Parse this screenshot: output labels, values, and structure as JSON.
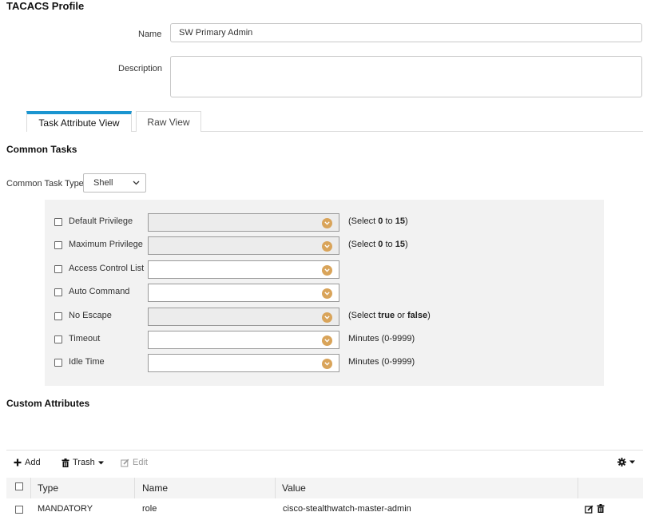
{
  "profile": {
    "title": "TACACS Profile",
    "name_label": "Name",
    "name_value": "SW Primary Admin",
    "description_label": "Description",
    "description_value": ""
  },
  "tabs": [
    {
      "label": "Task Attribute View",
      "active": true
    },
    {
      "label": "Raw View",
      "active": false
    }
  ],
  "common_tasks": {
    "heading": "Common Tasks",
    "type_label": "Common Task Type",
    "type_value": "Shell",
    "rows": [
      {
        "label": "Default Privilege",
        "disabled": true,
        "hint_pre": "(Select ",
        "hint_b1": "0",
        "hint_mid": " to ",
        "hint_b2": "15",
        "hint_post": ")"
      },
      {
        "label": "Maximum Privilege",
        "disabled": true,
        "hint_pre": "(Select ",
        "hint_b1": "0",
        "hint_mid": " to ",
        "hint_b2": "15",
        "hint_post": ")"
      },
      {
        "label": "Access Control List",
        "disabled": false,
        "hint_pre": "",
        "hint_b1": "",
        "hint_mid": "",
        "hint_b2": "",
        "hint_post": ""
      },
      {
        "label": "Auto Command",
        "disabled": false,
        "hint_pre": "",
        "hint_b1": "",
        "hint_mid": "",
        "hint_b2": "",
        "hint_post": ""
      },
      {
        "label": "No Escape",
        "disabled": true,
        "hint_pre": "(Select ",
        "hint_b1": "true",
        "hint_mid": " or ",
        "hint_b2": "false",
        "hint_post": ")"
      },
      {
        "label": "Timeout",
        "disabled": false,
        "hint_pre": "Minutes (0-9999)",
        "hint_b1": "",
        "hint_mid": "",
        "hint_b2": "",
        "hint_post": ""
      },
      {
        "label": "Idle Time",
        "disabled": false,
        "hint_pre": "Minutes (0-9999)",
        "hint_b1": "",
        "hint_mid": "",
        "hint_b2": "",
        "hint_post": ""
      }
    ]
  },
  "custom": {
    "heading": "Custom Attributes",
    "toolbar": {
      "add": "Add",
      "trash": "Trash",
      "edit": "Edit"
    },
    "columns": [
      "Type",
      "Name",
      "Value"
    ],
    "rows": [
      {
        "type": "MANDATORY",
        "name": "role",
        "value": "cisco-stealthwatch-master-admin"
      }
    ]
  },
  "colors": {
    "accent": "#1b95d0",
    "combo_button": "#d9a45a",
    "panel_bg": "#f2f2f2"
  }
}
